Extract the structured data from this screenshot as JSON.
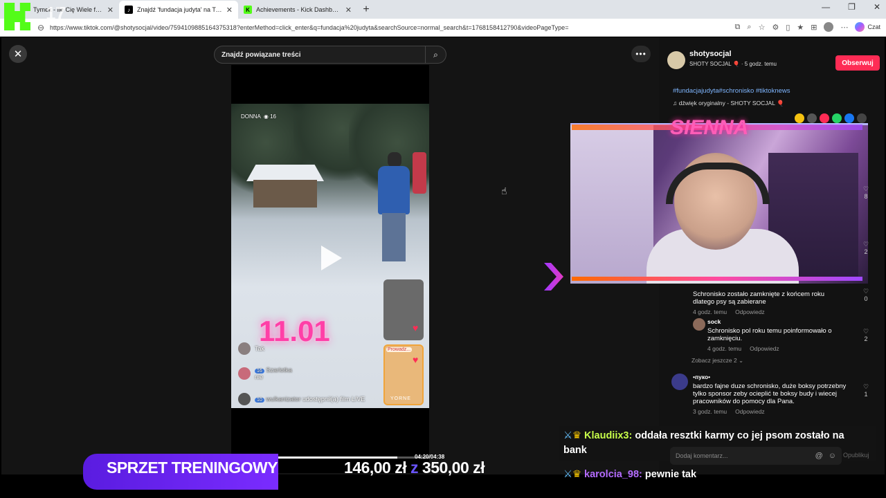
{
  "tabs": [
    {
      "label": "Tymek - Ile Cię Wiele ft. Big Scythe",
      "favicon_color": "#2a2a2a"
    },
    {
      "label": "Znajdź 'fundacja judyta' na TikTok",
      "favicon_color": "#000000"
    },
    {
      "label": "Achievements - Kick Dashboard",
      "favicon_color": "#53fc18"
    }
  ],
  "kick_overlay": {
    "logo": "K",
    "number": "17"
  },
  "address_bar": {
    "url": "https://www.tiktok.com/@shotysocjal/video/7594109885164375318?enterMethod=click_enter&q=fundacja%20judyta&searchSource=normal_search&t=1768158412790&videoPageType=",
    "copilot_label": "Czat"
  },
  "search": {
    "placeholder": "Znajdź powiązane treści"
  },
  "video": {
    "top_label": "DONNA",
    "top_count": "16",
    "big_date": "11.01",
    "progress": 0.85,
    "time": "04:20/04:38",
    "chat": [
      {
        "name": "",
        "text": "Tak",
        "badge": ""
      },
      {
        "name": "Szarlotka",
        "text": "nie",
        "badge": "16"
      },
      {
        "name": "wulkanizator",
        "text": "udostępnił(a) film LIVE",
        "badge": "10"
      }
    ],
    "side_card_tag": "Prowadz...",
    "side_card_label": "YORNE"
  },
  "author": {
    "name": "shotysocjal",
    "subtitle": "SHOTY SOCJAL 🎈 · 5 godz. temu",
    "follow_label": "Obserwuj",
    "hashtags": "#fundacjajudyta#schronisko #tiktoknews",
    "music": "dźwięk oryginalny - SHOTY SOCJAL 🎈"
  },
  "likes": {
    "first": "8",
    "second": "2",
    "third": "0",
    "fourth": "2",
    "fifth": "1"
  },
  "comments": [
    {
      "text": "Schronisko zostało zamknięte z końcem roku dlatego psy są zabierane",
      "time": "4 godz. temu",
      "reply": "Odpowiedz"
    },
    {
      "user": "sock",
      "text": "Schronisko pol roku temu poinformowało o zamknięciu.",
      "time": "4 godz. temu",
      "reply": "Odpowiedz"
    },
    {
      "user": "•пуко•",
      "text": "bardzo fajne duze schronisko, duże boksy potrzebny tylko sponsor zeby ocieplić te boksy budy i wiecej pracowników do pomocy dla Pana.",
      "time": "3 godz. temu",
      "reply": "Odpowiedz"
    }
  ],
  "see_more": "Zobacz jeszcze 2",
  "comment_input": {
    "placeholder": "Dodaj komentarz...",
    "publish": "Opublikuj"
  },
  "stream_overlay": {
    "sign": "SIENNA",
    "chat": [
      {
        "user": "Klaudiix3:",
        "text": "oddała resztki karmy co jej psom zostało na bank"
      },
      {
        "user": "karolcia_98:",
        "text": "pewnie tak"
      }
    ],
    "goal": {
      "label": "SPRZET TRENINGOWY",
      "current": "146,00 zł",
      "sep": "z",
      "target": "350,00 zł"
    }
  },
  "colors": {
    "accent": "#fe2c55",
    "kick_green": "#53fc18",
    "hashtag": "#7fb6ff"
  }
}
